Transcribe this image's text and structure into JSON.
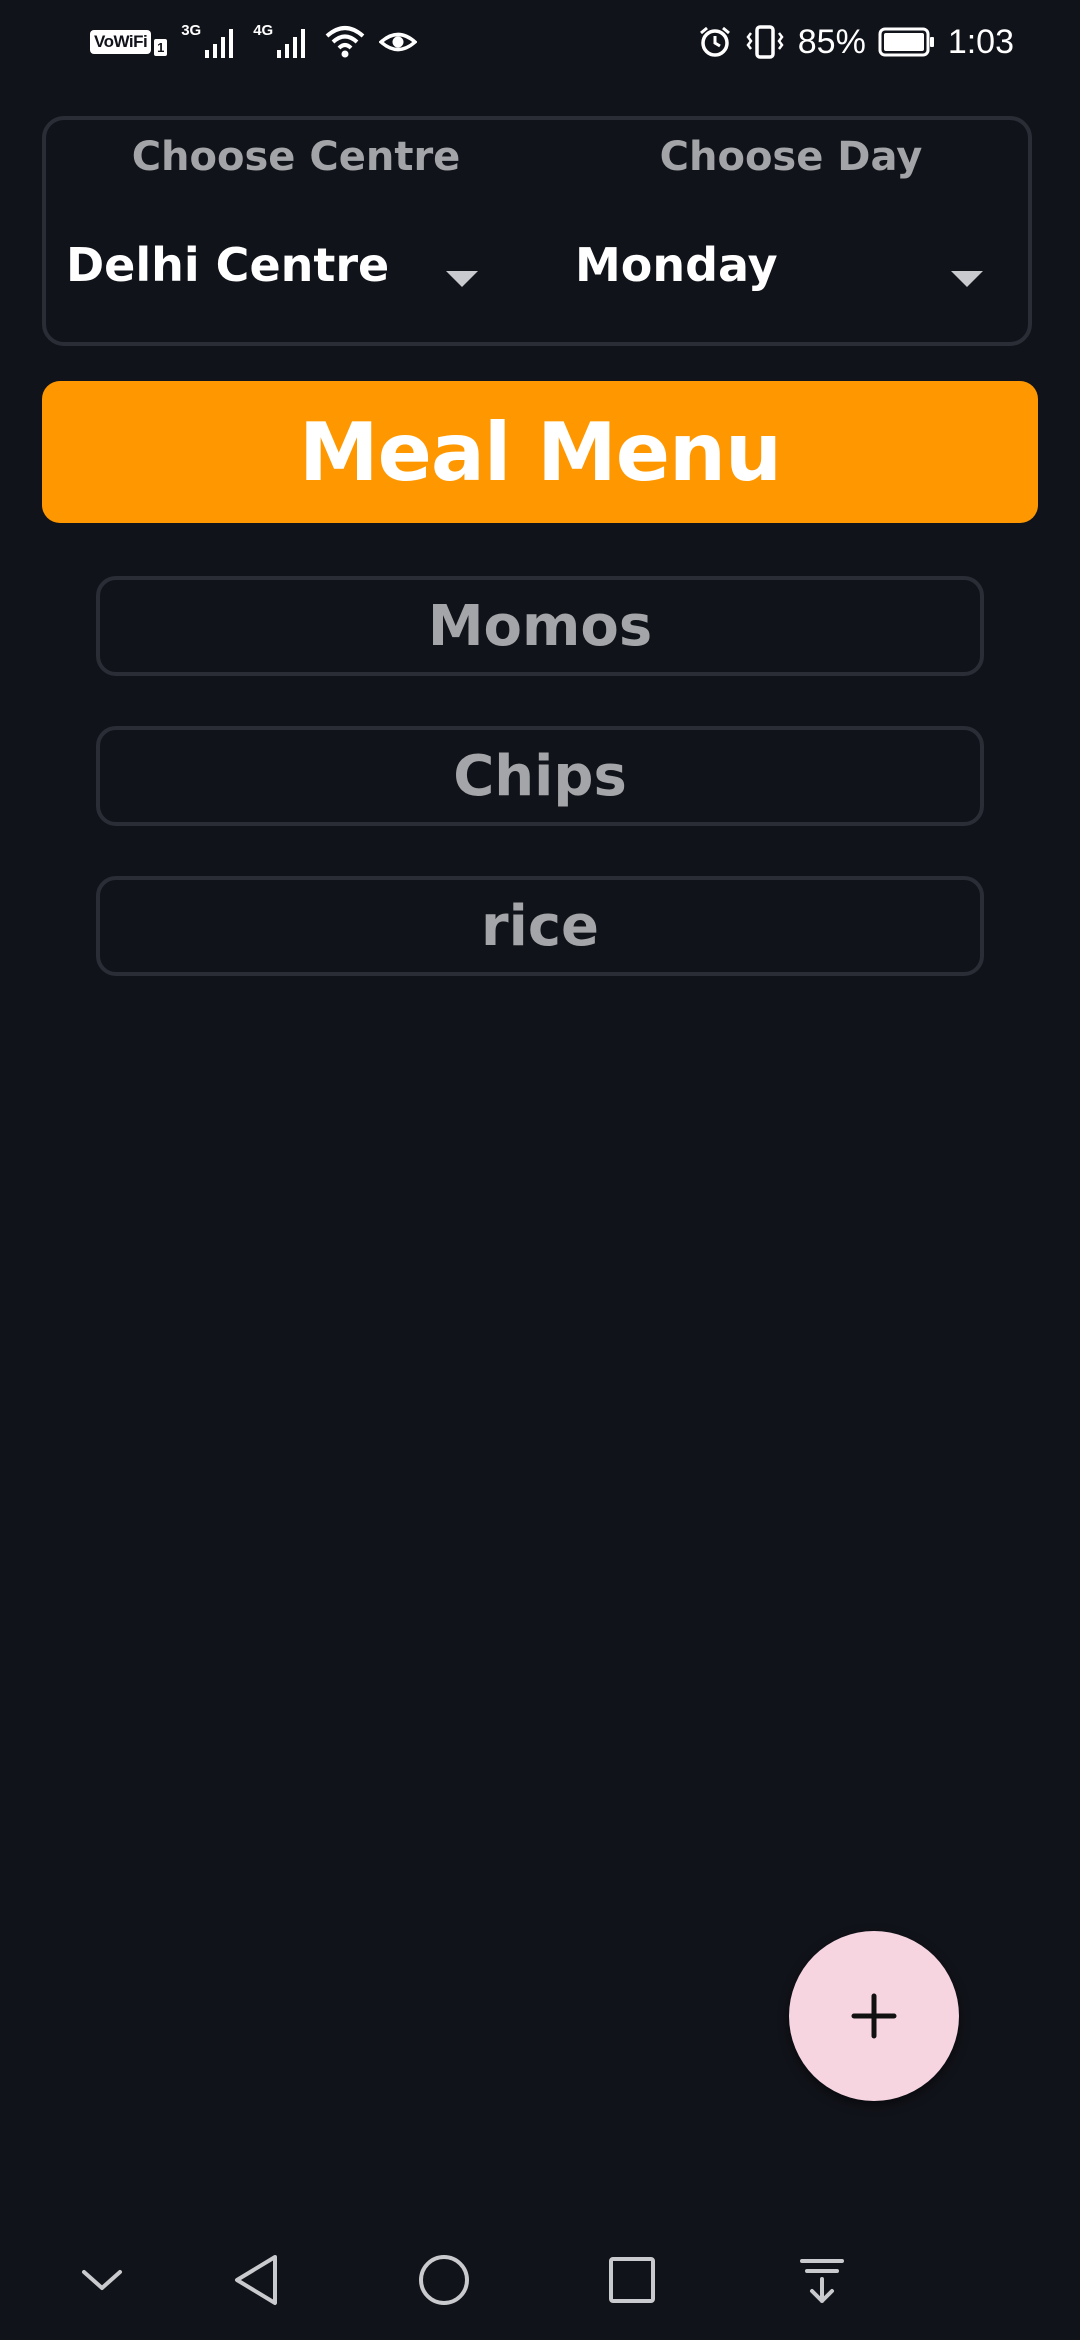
{
  "status_bar": {
    "vowifi_label": "VoWiFi",
    "sim_badge": "1",
    "network_1": "3G",
    "network_2": "4G",
    "battery_percent": "85%",
    "time": "1:03",
    "icons": [
      "vowifi-icon",
      "signal-3g-icon",
      "signal-4g-icon",
      "wifi-icon",
      "eye-comfort-icon",
      "alarm-icon",
      "vibrate-icon",
      "battery-icon"
    ]
  },
  "selectors": {
    "centre": {
      "label": "Choose Centre",
      "value": "Delhi Centre"
    },
    "day": {
      "label": "Choose Day",
      "value": "Monday"
    }
  },
  "header": {
    "title": "Meal Menu"
  },
  "meals": [
    {
      "name": "Momos"
    },
    {
      "name": "Chips"
    },
    {
      "name": "rice"
    }
  ],
  "fab": {
    "icon": "plus-icon"
  },
  "nav_bar": {
    "icons": [
      "collapse-chevron-icon",
      "back-icon",
      "home-icon",
      "recents-icon",
      "notification-pull-icon"
    ]
  },
  "colors": {
    "background": "#11131a",
    "accent": "#ff9800",
    "fab": "#f6d5e1",
    "border": "#2a2d35",
    "muted_text": "#a3a5a9"
  }
}
